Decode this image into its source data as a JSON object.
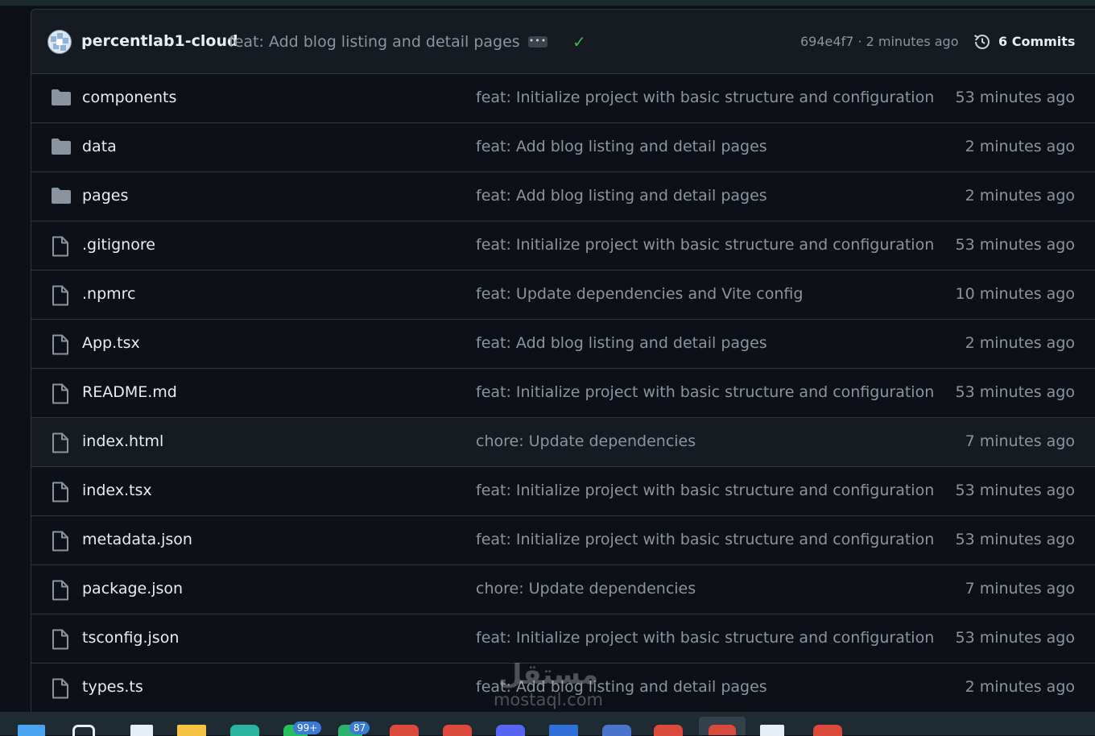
{
  "latest_commit": {
    "author": "percentlab1-cloud",
    "message": "feat: Add blog listing and detail pages",
    "ellipsis": "•••",
    "status": "✓",
    "hash_time": "694e4f7 · 2 minutes ago",
    "commits_label": "6 Commits"
  },
  "files": [
    {
      "name": "components",
      "type": "folder",
      "message": "feat: Initialize project with basic structure and configuration",
      "time": "53 minutes ago"
    },
    {
      "name": "data",
      "type": "folder",
      "message": "feat: Add blog listing and detail pages",
      "time": "2 minutes ago"
    },
    {
      "name": "pages",
      "type": "folder",
      "message": "feat: Add blog listing and detail pages",
      "time": "2 minutes ago"
    },
    {
      "name": ".gitignore",
      "type": "file",
      "message": "feat: Initialize project with basic structure and configuration",
      "time": "53 minutes ago"
    },
    {
      "name": ".npmrc",
      "type": "file",
      "message": "feat: Update dependencies and Vite config",
      "time": "10 minutes ago"
    },
    {
      "name": "App.tsx",
      "type": "file",
      "message": "feat: Add blog listing and detail pages",
      "time": "2 minutes ago"
    },
    {
      "name": "README.md",
      "type": "file",
      "message": "feat: Initialize project with basic structure and configuration",
      "time": "53 minutes ago"
    },
    {
      "name": "index.html",
      "type": "file",
      "message": "chore: Update dependencies",
      "time": "7 minutes ago"
    },
    {
      "name": "index.tsx",
      "type": "file",
      "message": "feat: Initialize project with basic structure and configuration",
      "time": "53 minutes ago"
    },
    {
      "name": "metadata.json",
      "type": "file",
      "message": "feat: Initialize project with basic structure and configuration",
      "time": "53 minutes ago"
    },
    {
      "name": "package.json",
      "type": "file",
      "message": "chore: Update dependencies",
      "time": "7 minutes ago"
    },
    {
      "name": "tsconfig.json",
      "type": "file",
      "message": "feat: Initialize project with basic structure and configuration",
      "time": "53 minutes ago"
    },
    {
      "name": "types.ts",
      "type": "file",
      "message": "feat: Add blog listing and detail pages",
      "time": "2 minutes ago"
    }
  ],
  "watermark": {
    "arabic": "مستقل",
    "latin": "mostaql.com"
  },
  "taskbar": {
    "badge_1": "99+",
    "badge_2": "87"
  },
  "colors": {
    "background": "#0d1117",
    "border": "#30363d",
    "muted": "#8b949e",
    "success": "#3fb950"
  }
}
